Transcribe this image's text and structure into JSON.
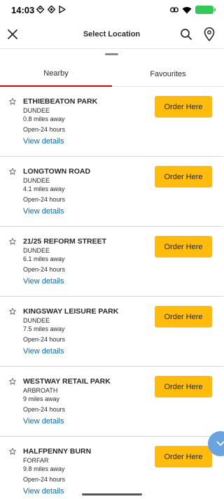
{
  "status_bar": {
    "time": "14:03",
    "left_icons": [
      "notification-icon",
      "nav-icon",
      "play-store-icon"
    ],
    "right_icons": [
      "link-icon",
      "wifi-icon",
      "battery-icon"
    ],
    "battery_color": "#34c759"
  },
  "header": {
    "title": "Select Location",
    "close_icon": "close-icon",
    "search_icon": "search-icon",
    "location_icon": "location-pin-icon"
  },
  "tabs": [
    {
      "label": "Nearby",
      "selected": true
    },
    {
      "label": "Favourites",
      "selected": false
    }
  ],
  "colors": {
    "accent_red": "#db0007",
    "button_yellow": "#ffbc0d",
    "link_blue": "#006bae"
  },
  "locations": [
    {
      "name": "ETHIEBEATON PARK",
      "city": "DUNDEE",
      "distance": "0.8 miles away",
      "hours": "Open-24 hours",
      "details": "View details",
      "button": "Order Here"
    },
    {
      "name": "LONGTOWN ROAD",
      "city": "DUNDEE",
      "distance": "4.1 miles away",
      "hours": "Open-24 hours",
      "details": "View details",
      "button": "Order Here"
    },
    {
      "name": "21/25 REFORM STREET",
      "city": "DUNDEE",
      "distance": "6.1 miles away",
      "hours": "Open-24 hours",
      "details": "View details",
      "button": "Order Here"
    },
    {
      "name": "KINGSWAY LEISURE PARK",
      "city": "DUNDEE",
      "distance": "7.5 miles away",
      "hours": "Open-24 hours",
      "details": "View details",
      "button": "Order Here"
    },
    {
      "name": "WESTWAY RETAIL PARK",
      "city": "ARBROATH",
      "distance": "9 miles away",
      "hours": "Open-24 hours",
      "details": "View details",
      "button": "Order Here"
    },
    {
      "name": "HALFPENNY BURN",
      "city": "FORFAR",
      "distance": "9.8 miles away",
      "hours": "Open-24 hours",
      "details": "View details",
      "button": "Order Here"
    }
  ]
}
